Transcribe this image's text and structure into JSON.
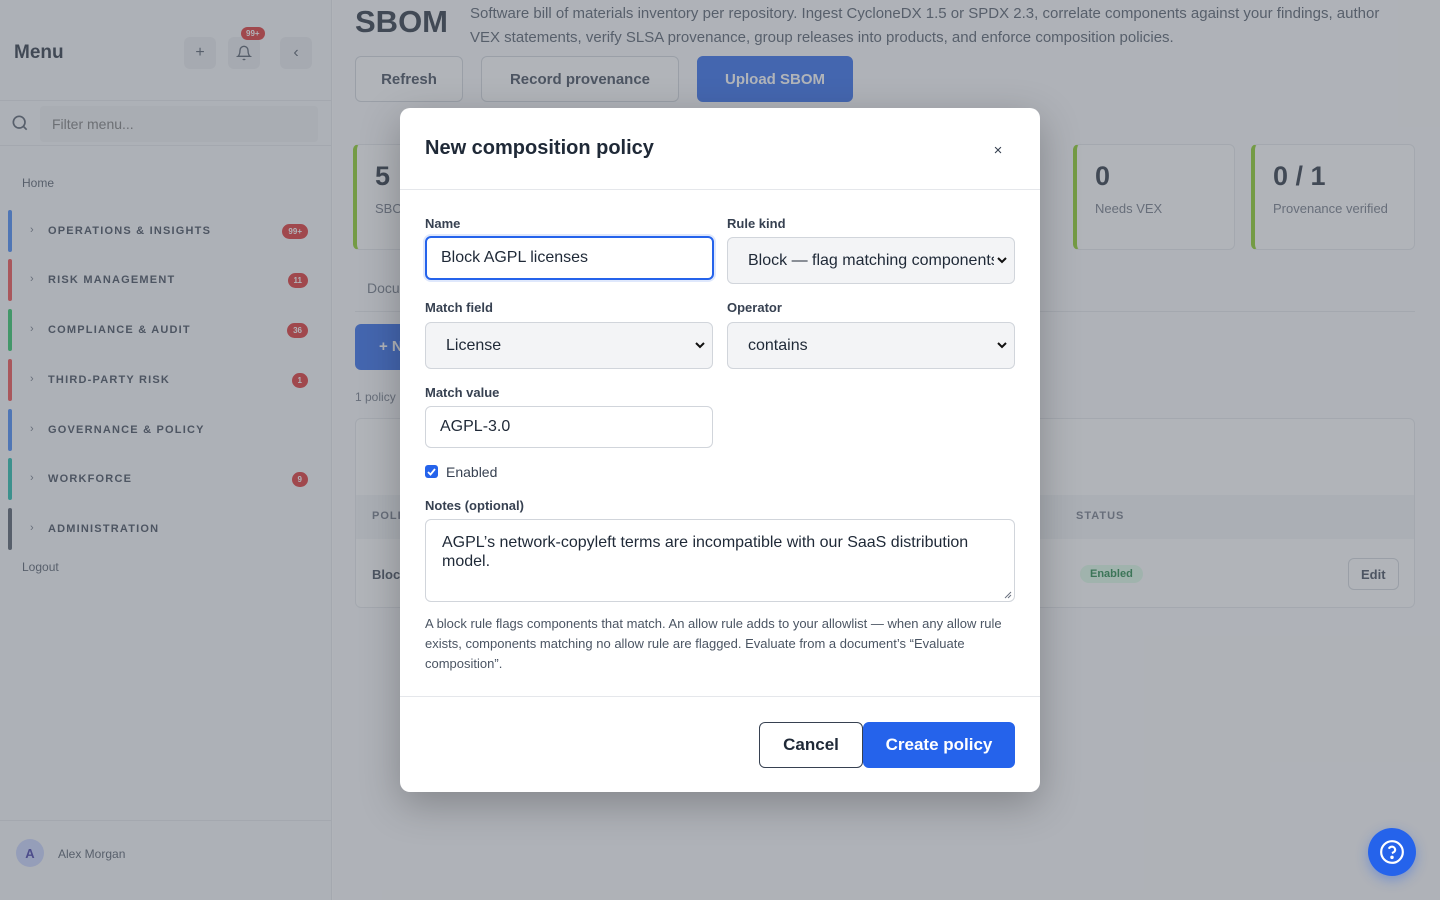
{
  "sidebar": {
    "title": "Menu",
    "add_icon": "plus-icon",
    "bell_icon": "bell-icon",
    "bell_badge": "99+",
    "collapse_icon": "chevron-left-icon",
    "filter_placeholder": "Filter menu...",
    "home": "Home",
    "items": [
      {
        "label": "OPERATIONS & INSIGHTS",
        "badge": "99+",
        "color": "#3b82f6"
      },
      {
        "label": "RISK MANAGEMENT",
        "badge": "11",
        "color": "#ef4444"
      },
      {
        "label": "COMPLIANCE & AUDIT",
        "badge": "36",
        "color": "#22c55e"
      },
      {
        "label": "THIRD-PARTY RISK",
        "badge": "1",
        "color": "#ef4444"
      },
      {
        "label": "GOVERNANCE & POLICY",
        "badge": "",
        "color": "#3b82f6"
      },
      {
        "label": "WORKFORCE",
        "badge": "9",
        "color": "#14b8a6"
      },
      {
        "label": "ADMINISTRATION",
        "badge": "",
        "color": "#4b5563"
      }
    ],
    "logout": "Logout",
    "user": {
      "initial": "A",
      "name": "Alex Morgan"
    }
  },
  "page": {
    "title": "SBOM",
    "description": "Software bill of materials inventory per repository. Ingest CycloneDX 1.5 or SPDX 2.3, correlate components against your findings, author VEX statements, verify SLSA provenance, group releases into products, and enforce composition policies.",
    "buttons": {
      "refresh": "Refresh",
      "provenance": "Record provenance",
      "upload": "Upload SBOM"
    },
    "stats": [
      {
        "value": "5",
        "label": "SBOMs"
      },
      {
        "value": "0",
        "label": "Needs VEX"
      },
      {
        "value": "0 / 1",
        "label": "Provenance verified"
      }
    ],
    "tab": "Documents",
    "new_button": "+ N",
    "count": "1 policy",
    "table": {
      "col_policy": "POLICY",
      "col_status": "STATUS",
      "row_name": "Block",
      "row_status": "Enabled",
      "edit": "Edit"
    }
  },
  "modal": {
    "title": "New composition policy",
    "close_icon": "close-icon",
    "name_label": "Name",
    "name_value": "Block AGPL licenses",
    "rule_kind_label": "Rule kind",
    "rule_kind_value": "Block — flag matching components",
    "match_field_label": "Match field",
    "match_field_value": "License",
    "operator_label": "Operator",
    "operator_value": "contains",
    "match_value_label": "Match value",
    "match_value_value": "AGPL-3.0",
    "enabled_label": "Enabled",
    "enabled": true,
    "notes_label": "Notes (optional)",
    "notes_value": "AGPL’s network-copyleft terms are incompatible with our SaaS distribution model.",
    "help": "A block rule flags components that match. An allow rule adds to your allowlist — when any allow rule exists, components matching no allow rule are flagged. Evaluate from a document’s “Evaluate composition”.",
    "cancel": "Cancel",
    "create": "Create policy"
  },
  "help_fab_icon": "help-circle-icon",
  "colors": {
    "accent": "#2563eb",
    "danger": "#dc2626",
    "success": "#15803d"
  }
}
